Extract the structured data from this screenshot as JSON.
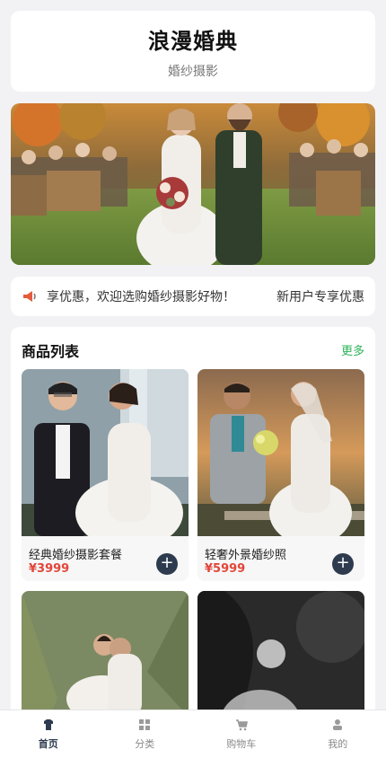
{
  "header": {
    "title": "浪漫婚典",
    "subtitle": "婚纱摄影"
  },
  "notice": {
    "icon": "megaphone-icon",
    "text_primary": "享优惠，欢迎选购婚纱摄影好物！",
    "text_secondary": "新用户专享优惠"
  },
  "products": {
    "section_title": "商品列表",
    "more_label": "更多",
    "items": [
      {
        "name": "经典婚纱摄影套餐",
        "price": "¥3999",
        "add_icon": "plus-icon"
      },
      {
        "name": "轻奢外景婚纱照",
        "price": "¥5999",
        "add_icon": "plus-icon"
      }
    ]
  },
  "tabbar": {
    "items": [
      {
        "label": "首页",
        "icon": "shirt-icon",
        "active": true
      },
      {
        "label": "分类",
        "icon": "grid-icon",
        "active": false
      },
      {
        "label": "购物车",
        "icon": "cart-icon",
        "active": false
      },
      {
        "label": "我的",
        "icon": "person-icon",
        "active": false
      }
    ]
  },
  "colors": {
    "accent_dark": "#2e3b4e",
    "price_red": "#e0463a",
    "more_green": "#2db35a",
    "background": "#f2f2f4"
  }
}
